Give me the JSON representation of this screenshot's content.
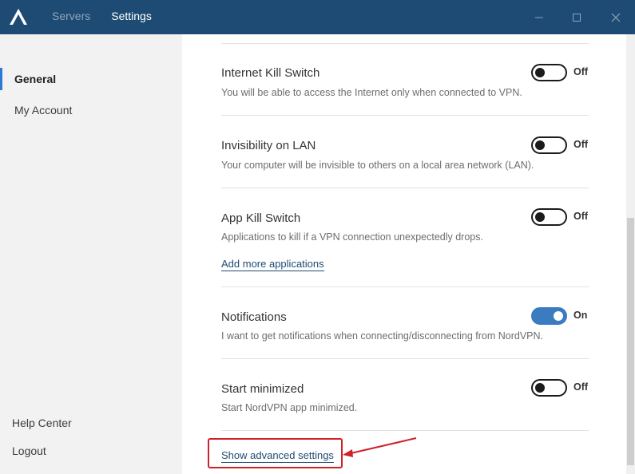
{
  "titlebar": {
    "nav": [
      {
        "label": "Servers",
        "active": false
      },
      {
        "label": "Settings",
        "active": true
      }
    ],
    "icons": {
      "logo": "nordvpn-logo",
      "minimize": "minimize-icon",
      "maximize": "maximize-icon",
      "close": "close-icon"
    }
  },
  "sidebar": {
    "items": [
      {
        "label": "General",
        "active": true
      },
      {
        "label": "My Account",
        "active": false
      }
    ],
    "bottom": [
      {
        "label": "Help Center"
      },
      {
        "label": "Logout"
      }
    ]
  },
  "settings": [
    {
      "title": "Internet Kill Switch",
      "description": "You will be able to access the Internet only when connected to VPN.",
      "state": "Off"
    },
    {
      "title": "Invisibility on LAN",
      "description": "Your computer will be invisible to others on a local area network (LAN).",
      "state": "Off"
    },
    {
      "title": "App Kill Switch",
      "description": "Applications to kill if a VPN connection unexpectedly drops.",
      "state": "Off",
      "link": "Add more applications"
    },
    {
      "title": "Notifications",
      "description": "I want to get notifications when connecting/disconnecting from NordVPN.",
      "state": "On"
    },
    {
      "title": "Start minimized",
      "description": "Start NordVPN app minimized.",
      "state": "Off"
    }
  ],
  "advanced_link": "Show advanced settings",
  "colors": {
    "titlebar": "#1e4b73",
    "accent": "#2d7ad6",
    "toggle_on": "#3b7bbf",
    "annotation": "#d0202a"
  }
}
